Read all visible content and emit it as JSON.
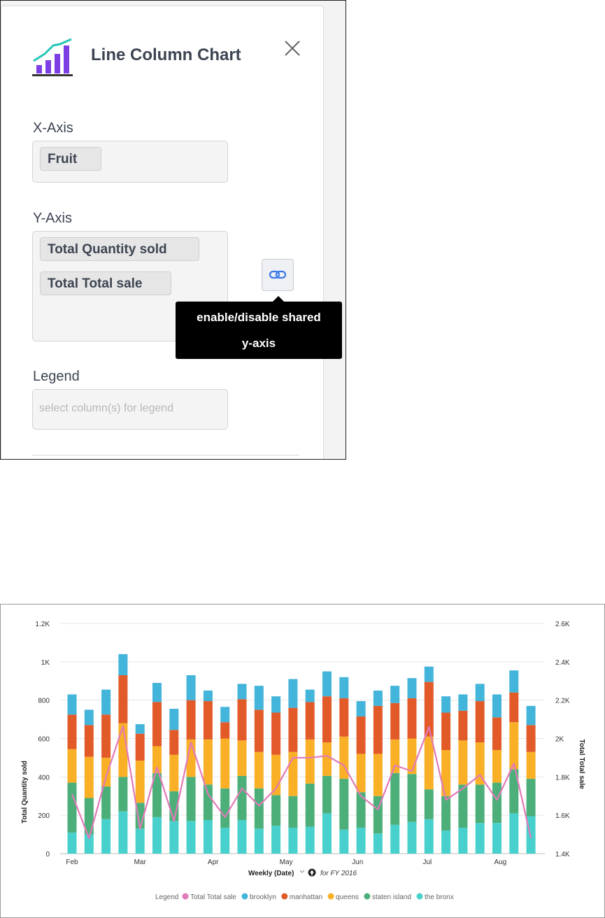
{
  "panel": {
    "title": "Line Column Chart",
    "chart_type_icon": "line-column-chart-icon",
    "close_icon": "close-icon",
    "x_axis": {
      "label": "X-Axis",
      "columns": [
        "Fruit"
      ]
    },
    "y_axis": {
      "label": "Y-Axis",
      "columns": [
        "Total Quantity sold",
        "Total Total sale"
      ]
    },
    "shared_axis_button": {
      "icon": "link-icon",
      "tooltip_line1": "enable/disable shared",
      "tooltip_line2": "y-axis"
    },
    "legend": {
      "label": "Legend",
      "placeholder": "select column(s) for legend"
    },
    "colors": {
      "icon_purple": "#7b3fe4",
      "icon_teal": "#26c6b8",
      "link_blue": "#3a7ae8"
    }
  },
  "chart_data": {
    "type": "bar",
    "subtype": "stacked column with line overlay",
    "xlabel": "Weekly (Date)",
    "x_filter": "for FY 2016",
    "ylabel_left": "Total Quantity sold",
    "ylabel_right": "Total Total sale",
    "left_ticks": [
      "0",
      "200",
      "400",
      "600",
      "800",
      "1K",
      "1.2K"
    ],
    "right_ticks": [
      "1.4K",
      "1.6K",
      "1.8K",
      "2K",
      "2.2K",
      "2.4K",
      "2.6K"
    ],
    "ylim_left": [
      0,
      1200
    ],
    "ylim_right": [
      1400,
      2600
    ],
    "month_labels": [
      "Feb",
      "Mar",
      "Apr",
      "May",
      "Jun",
      "Jul",
      "Aug"
    ],
    "month_label_week_index": [
      0,
      4,
      8.3,
      12.6,
      16.8,
      20.9,
      25.2
    ],
    "grid": true,
    "legend_position": "bottom",
    "legend_title": "Legend",
    "series": [
      {
        "name": "the bronx",
        "color": "#48d1cc",
        "values": [
          110,
          100,
          180,
          220,
          130,
          190,
          170,
          170,
          175,
          135,
          175,
          130,
          145,
          135,
          140,
          210,
          125,
          135,
          105,
          150,
          165,
          180,
          120,
          135,
          160,
          160,
          210,
          195
        ]
      },
      {
        "name": "staten island",
        "color": "#4caf7a",
        "values": [
          260,
          190,
          170,
          180,
          135,
          230,
          155,
          230,
          185,
          205,
          230,
          210,
          160,
          165,
          225,
          195,
          265,
          185,
          195,
          270,
          250,
          155,
          180,
          225,
          200,
          210,
          230,
          195
        ]
      },
      {
        "name": "queens",
        "color": "#f9b027",
        "values": [
          175,
          215,
          150,
          280,
          220,
          140,
          190,
          195,
          235,
          260,
          185,
          190,
          210,
          230,
          230,
          175,
          220,
          200,
          220,
          175,
          185,
          275,
          240,
          230,
          220,
          170,
          245,
          140
        ]
      },
      {
        "name": "manhattan",
        "color": "#e35a29",
        "values": [
          180,
          165,
          225,
          250,
          140,
          230,
          130,
          205,
          200,
          85,
          215,
          220,
          220,
          230,
          195,
          240,
          200,
          195,
          250,
          190,
          210,
          285,
          195,
          155,
          215,
          170,
          155,
          140
        ]
      },
      {
        "name": "brooklyn",
        "color": "#43b4da",
        "values": [
          105,
          80,
          130,
          110,
          50,
          100,
          110,
          130,
          55,
          80,
          80,
          125,
          85,
          150,
          65,
          130,
          110,
          80,
          80,
          90,
          105,
          80,
          85,
          85,
          90,
          120,
          115,
          100
        ]
      }
    ],
    "line": {
      "name": "Total Total sale",
      "color": "#e27ab8",
      "values": [
        1710,
        1480,
        1800,
        2065,
        1530,
        1850,
        1570,
        1980,
        1710,
        1590,
        1740,
        1650,
        1740,
        1900,
        1900,
        1910,
        1860,
        1700,
        1630,
        1860,
        1830,
        2060,
        1680,
        1740,
        1810,
        1680,
        1870,
        1480
      ]
    }
  }
}
